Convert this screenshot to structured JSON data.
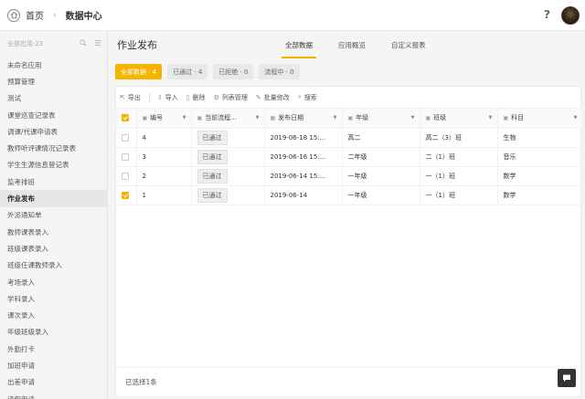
{
  "header": {
    "home_label": "首页",
    "separator": "›",
    "current": "数据中心",
    "help": "?"
  },
  "sidebar": {
    "head": "全部应用·23",
    "items": [
      {
        "label": "未命名应用"
      },
      {
        "label": "预算管理"
      },
      {
        "label": "测试"
      },
      {
        "label": "课堂巡查记录表"
      },
      {
        "label": "调课/代课申请表"
      },
      {
        "label": "教师听评课情况记录表"
      },
      {
        "label": "学生生源信息登记表"
      },
      {
        "label": "监考排班"
      },
      {
        "label": "作业发布",
        "active": true
      },
      {
        "label": "外派通知单"
      },
      {
        "label": "教师课表录入"
      },
      {
        "label": "班级课表录入"
      },
      {
        "label": "班级任课教师录入"
      },
      {
        "label": "考场录入"
      },
      {
        "label": "学科录入"
      },
      {
        "label": "课次录入"
      },
      {
        "label": "年级班级录入"
      },
      {
        "label": "外勤打卡"
      },
      {
        "label": "加班申请"
      },
      {
        "label": "出差申请"
      },
      {
        "label": "请假申请"
      }
    ]
  },
  "main": {
    "title": "作业发布",
    "tabs": [
      "全部数据",
      "应用概览",
      "自定义报表"
    ],
    "active_tab": 0,
    "filters": [
      {
        "label": "全部数据 · 4",
        "active": true
      },
      {
        "label": "已通过 · 4"
      },
      {
        "label": "已拒绝 · 0"
      },
      {
        "label": "流程中 · 0"
      }
    ],
    "toolbar": {
      "export": "导出",
      "import": "导入",
      "delete": "删除",
      "columns": "列表管理",
      "batch_edit": "批量修改",
      "search": "搜索"
    },
    "columns": [
      "编号",
      "当前流程...",
      "发布日期",
      "年级",
      "班级",
      "科目"
    ],
    "rows": [
      {
        "checked": false,
        "id": "4",
        "status": "已通过",
        "date": "2019-06-18 15:...",
        "grade": "高二",
        "class": "高二（3）班",
        "subject": "生物"
      },
      {
        "checked": false,
        "id": "3",
        "status": "已通过",
        "date": "2019-06-16 15:...",
        "grade": "二年级",
        "class": "二（1）班",
        "subject": "音乐"
      },
      {
        "checked": false,
        "id": "2",
        "status": "已通过",
        "date": "2019-06-14 15:...",
        "grade": "一年级",
        "class": "一（1）班",
        "subject": "数学"
      },
      {
        "checked": true,
        "id": "1",
        "status": "已通过",
        "date": "2019-06-14",
        "grade": "一年级",
        "class": "一（1）班",
        "subject": "数学"
      }
    ],
    "footer": "已选择1条"
  },
  "colors": {
    "accent": "#f4b400"
  }
}
